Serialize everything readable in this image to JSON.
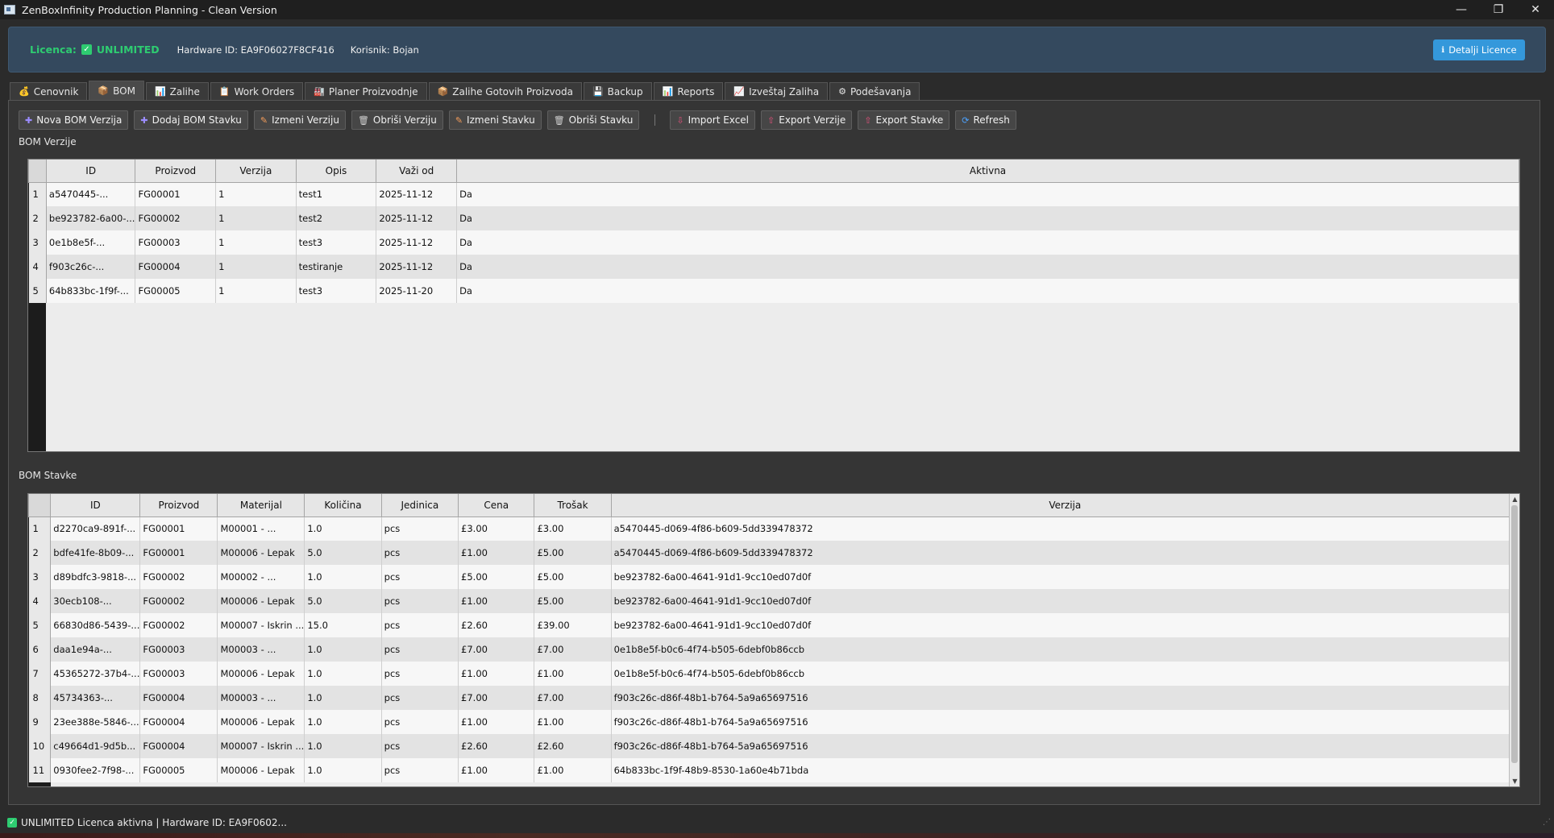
{
  "window": {
    "title": "ZenBoxInfinity Production Planning - Clean Version",
    "minimize": "—",
    "maximize": "❐",
    "close": "✕"
  },
  "license": {
    "label": "Licenca:",
    "value": "UNLIMITED",
    "hardware": "Hardware ID: EA9F06027F8CF416",
    "user": "Korisnik: Bojan",
    "details_button": "Detalji Licence",
    "colors": {
      "accent": "#2ecc71",
      "panel": "#34495e",
      "button": "#3498db"
    }
  },
  "tabs": [
    {
      "label": "Cenovnik",
      "icon": "money-bag-icon",
      "glyph": "💰"
    },
    {
      "label": "BOM",
      "icon": "box-icon",
      "glyph": "📦"
    },
    {
      "label": "Zalihe",
      "icon": "bar-chart-icon",
      "glyph": "📊"
    },
    {
      "label": "Work Orders",
      "icon": "clipboard-icon",
      "glyph": "📋"
    },
    {
      "label": "Planer Proizvodnje",
      "icon": "factory-icon",
      "glyph": "🏭"
    },
    {
      "label": "Zalihe Gotovih Proizvoda",
      "icon": "package-icon",
      "glyph": "📦"
    },
    {
      "label": "Backup",
      "icon": "save-icon",
      "glyph": "💾"
    },
    {
      "label": "Reports",
      "icon": "report-icon",
      "glyph": "📊"
    },
    {
      "label": "Izveštaj Zaliha",
      "icon": "trend-chart-icon",
      "glyph": "📈"
    },
    {
      "label": "Podešavanja",
      "icon": "gear-icon",
      "glyph": "⚙"
    }
  ],
  "active_tab": "BOM",
  "toolbar": {
    "nova_bom_verzija": "Nova BOM Verzija",
    "dodaj_bom_stavku": "Dodaj BOM Stavku",
    "izmeni_verziju": "Izmeni Verziju",
    "obrisi_verziju": "Obriši Verziju",
    "izmeni_stavku": "Izmeni Stavku",
    "obrisi_stavku": "Obriši Stavku",
    "separator": "|",
    "import_excel": "Import Excel",
    "export_verzije": "Export Verzije",
    "export_stavke": "Export Stavke",
    "refresh": "Refresh"
  },
  "bom_verzije": {
    "section_label": "BOM Verzije",
    "columns": [
      "ID",
      "Proizvod",
      "Verzija",
      "Opis",
      "Važi od",
      "Aktivna"
    ],
    "rows": [
      [
        "a5470445-...",
        "FG00001",
        "1",
        "test1",
        "2025-11-12",
        "Da"
      ],
      [
        "be923782-6a00-...",
        "FG00002",
        "1",
        "test2",
        "2025-11-12",
        "Da"
      ],
      [
        "0e1b8e5f-...",
        "FG00003",
        "1",
        "test3",
        "2025-11-12",
        "Da"
      ],
      [
        "f903c26c-...",
        "FG00004",
        "1",
        "testiranje",
        "2025-11-12",
        "Da"
      ],
      [
        "64b833bc-1f9f-...",
        "FG00005",
        "1",
        "test3",
        "2025-11-20",
        "Da"
      ]
    ]
  },
  "bom_stavke": {
    "section_label": "BOM Stavke",
    "columns": [
      "ID",
      "Proizvod",
      "Materijal",
      "Količina",
      "Jedinica",
      "Cena",
      "Trošak",
      "Verzija"
    ],
    "rows": [
      [
        "d2270ca9-891f-...",
        "FG00001",
        "M00001 - ...",
        "1.0",
        "pcs",
        "£3.00",
        "£3.00",
        "a5470445-d069-4f86-b609-5dd339478372"
      ],
      [
        "bdfe41fe-8b09-...",
        "FG00001",
        "M00006 - Lepak",
        "5.0",
        "pcs",
        "£1.00",
        "£5.00",
        "a5470445-d069-4f86-b609-5dd339478372"
      ],
      [
        "d89bdfc3-9818-...",
        "FG00002",
        "M00002 - ...",
        "1.0",
        "pcs",
        "£5.00",
        "£5.00",
        "be923782-6a00-4641-91d1-9cc10ed07d0f"
      ],
      [
        "30ecb108-...",
        "FG00002",
        "M00006 - Lepak",
        "5.0",
        "pcs",
        "£1.00",
        "£5.00",
        "be923782-6a00-4641-91d1-9cc10ed07d0f"
      ],
      [
        "66830d86-5439-...",
        "FG00002",
        "M00007 - Iskrin ...",
        "15.0",
        "pcs",
        "£2.60",
        "£39.00",
        "be923782-6a00-4641-91d1-9cc10ed07d0f"
      ],
      [
        "daa1e94a-...",
        "FG00003",
        "M00003 - ...",
        "1.0",
        "pcs",
        "£7.00",
        "£7.00",
        "0e1b8e5f-b0c6-4f74-b505-6debf0b86ccb"
      ],
      [
        "45365272-37b4-...",
        "FG00003",
        "M00006 - Lepak",
        "1.0",
        "pcs",
        "£1.00",
        "£1.00",
        "0e1b8e5f-b0c6-4f74-b505-6debf0b86ccb"
      ],
      [
        "45734363-...",
        "FG00004",
        "M00003 - ...",
        "1.0",
        "pcs",
        "£7.00",
        "£7.00",
        "f903c26c-d86f-48b1-b764-5a9a65697516"
      ],
      [
        "23ee388e-5846-...",
        "FG00004",
        "M00006 - Lepak",
        "1.0",
        "pcs",
        "£1.00",
        "£1.00",
        "f903c26c-d86f-48b1-b764-5a9a65697516"
      ],
      [
        "c49664d1-9d5b...",
        "FG00004",
        "M00007 - Iskrin ...",
        "1.0",
        "pcs",
        "£2.60",
        "£2.60",
        "f903c26c-d86f-48b1-b764-5a9a65697516"
      ],
      [
        "0930fee2-7f98-...",
        "FG00005",
        "M00006 - Lepak",
        "1.0",
        "pcs",
        "£1.00",
        "£1.00",
        "64b833bc-1f9f-48b9-8530-1a60e4b71bda"
      ]
    ]
  },
  "statusbar": {
    "text": "UNLIMITED Licenca aktivna | Hardware ID: EA9F0602..."
  }
}
